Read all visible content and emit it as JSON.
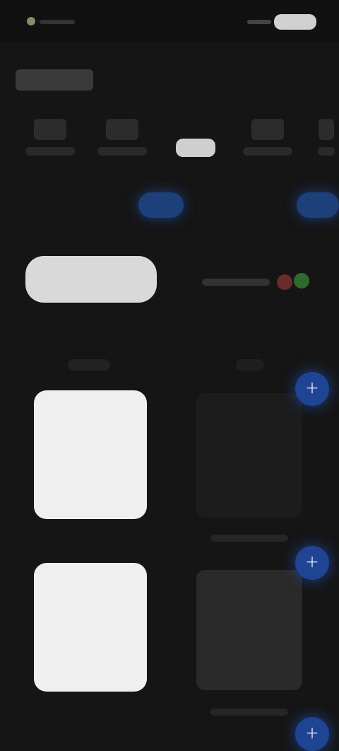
{
  "status_bar": {},
  "section": {
    "title": ""
  },
  "tabs": [
    {
      "label": ""
    },
    {
      "label": ""
    },
    {
      "label": "",
      "active": true
    },
    {
      "label": ""
    },
    {
      "label": ""
    }
  ],
  "pills": {
    "left": "",
    "right": ""
  },
  "toggle": {
    "label": ""
  },
  "cards": [
    {
      "caption": ""
    },
    {
      "caption": ""
    },
    {
      "caption": ""
    },
    {
      "caption": ""
    }
  ],
  "colors": {
    "background": "#151515",
    "accent_blue": "#1f4494",
    "surface": "#1c1c1c"
  },
  "icons": {
    "add_button": "plus-icon"
  }
}
